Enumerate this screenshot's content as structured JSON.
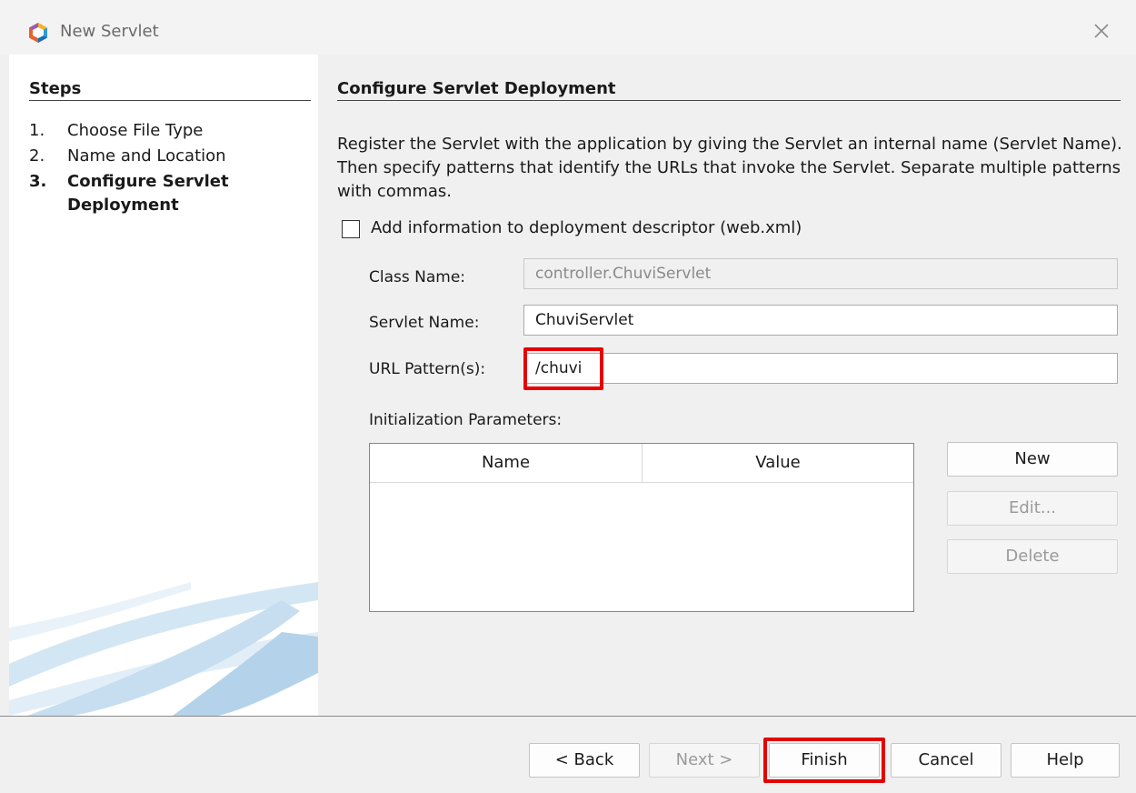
{
  "window": {
    "title": "New Servlet",
    "icon": "netbeans-logo-icon",
    "close_icon": "close-icon"
  },
  "steps": {
    "title": "Steps",
    "items": [
      {
        "num": "1.",
        "label": "Choose File Type"
      },
      {
        "num": "2.",
        "label": "Name and Location"
      },
      {
        "num": "3.",
        "label": "Configure Servlet Deployment",
        "current": true
      }
    ]
  },
  "main": {
    "title": "Configure Servlet Deployment",
    "description": "Register the Servlet with the application by giving the Servlet an internal name (Servlet Name). Then specify patterns that identify the URLs that invoke the Servlet. Separate multiple patterns with commas.",
    "checkbox": {
      "label": "Add information to deployment descriptor (web.xml)",
      "checked": false
    },
    "class_name": {
      "label": "Class Name:",
      "value": "controller.ChuviServlet"
    },
    "servlet_name": {
      "label": "Servlet Name:",
      "value": "ChuviServlet"
    },
    "url_pattern": {
      "label": "URL Pattern(s):",
      "value": "/chuvi"
    },
    "init_params": {
      "label": "Initialization Parameters:",
      "columns": [
        "Name",
        "Value"
      ],
      "rows": []
    },
    "side_buttons": {
      "new": "New",
      "edit": "Edit...",
      "delete": "Delete"
    }
  },
  "footer": {
    "back": "< Back",
    "next": "Next >",
    "finish": "Finish",
    "cancel": "Cancel",
    "help": "Help"
  },
  "colors": {
    "highlight": "#e60000",
    "background": "#f0f0f0"
  }
}
